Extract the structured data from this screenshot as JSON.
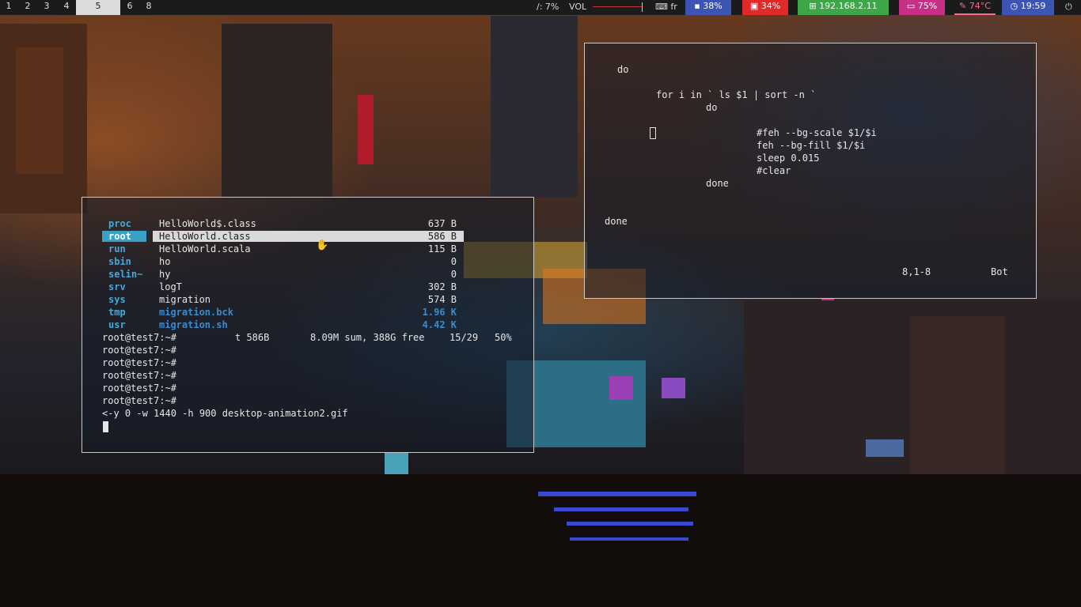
{
  "topbar": {
    "workspaces": [
      "1",
      "2",
      "3",
      "4",
      "5",
      "6",
      "8"
    ],
    "active_workspace": "5",
    "disk": "/: 7%",
    "vol_label": "VOL",
    "layout": "fr",
    "mem": "38%",
    "cpu": "34%",
    "ip": "192.168.2.11",
    "battery": "75%",
    "temp": "74°C",
    "time": "19:59",
    "colors": {
      "mem": "#3c55b4",
      "cpu": "#e02a2a",
      "ip": "#3ca648",
      "battery": "#c83088",
      "temp_text": "#ff6a8a",
      "time": "#3c55b4"
    }
  },
  "file_manager": {
    "left_column": [
      {
        "name": "proc"
      },
      {
        "name": "root"
      },
      {
        "name": "run"
      },
      {
        "name": "sbin"
      },
      {
        "name": "selin~"
      },
      {
        "name": "srv"
      },
      {
        "name": "sys"
      },
      {
        "name": "tmp"
      },
      {
        "name": "usr"
      }
    ],
    "files": [
      {
        "name": "HelloWorld$.class",
        "size": "637 B"
      },
      {
        "name": "HelloWorld.class",
        "size": "586 B"
      },
      {
        "name": "HelloWorld.scala",
        "size": "115 B"
      },
      {
        "name": "ho",
        "size": "0"
      },
      {
        "name": "hy",
        "size": "0"
      },
      {
        "name": "logT",
        "size": "302 B"
      },
      {
        "name": "migration",
        "size": "574 B"
      },
      {
        "name": "migration.bck",
        "size": "1.96 K"
      },
      {
        "name": "migration.sh",
        "size": "4.42 K"
      }
    ],
    "selected_left": "root",
    "selected_file": "HelloWorld.class",
    "status": {
      "prompt": "root@test7:~#",
      "info": "t 586B",
      "sum": "8.09M sum, 388G free",
      "position": "15/29",
      "percent": "50%"
    },
    "prompts": [
      "root@test7:~#",
      "root@test7:~#",
      "root@test7:~#",
      "root@test7:~#",
      "root@test7:~#"
    ],
    "command": "<-y 0 -w 1440 -h 900 desktop-animation2.gif"
  },
  "editor": {
    "lines": [
      "do",
      "for i in ` ls $1 | sort -n `",
      "do",
      "#feh --bg-scale $1/$i",
      "feh --bg-fill $1/$i",
      "sleep 0.015",
      "#clear",
      "done",
      "done"
    ],
    "ruler": "8,1-8",
    "scroll": "Bot"
  }
}
